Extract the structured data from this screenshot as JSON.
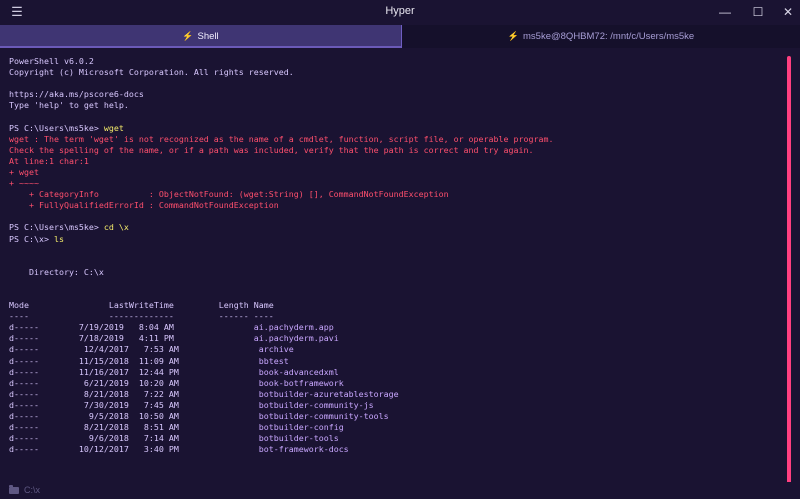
{
  "window": {
    "title": "Hyper",
    "menu_icon": "hamburger-icon",
    "minimize_icon": "minimize-icon",
    "maximize_icon": "maximize-icon",
    "close_icon": "close-icon"
  },
  "tabs": [
    {
      "label": "Shell",
      "icon": "bolt-icon",
      "active": true
    },
    {
      "label": "ms5ke@8QHBM72: /mnt/c/Users/ms5ke",
      "icon": "bolt-icon",
      "active": false
    }
  ],
  "terminal": {
    "lines": [
      {
        "segs": [
          {
            "t": "PowerShell v6.0.2",
            "c": "lav"
          }
        ]
      },
      {
        "segs": [
          {
            "t": "Copyright (c) Microsoft Corporation. All rights reserved.",
            "c": "lav"
          }
        ]
      },
      {
        "segs": [
          {
            "t": "",
            "c": "lav"
          }
        ]
      },
      {
        "segs": [
          {
            "t": "https://aka.ms/pscore6-docs",
            "c": "lav"
          }
        ]
      },
      {
        "segs": [
          {
            "t": "Type 'help' to get help.",
            "c": "lav"
          }
        ]
      },
      {
        "segs": [
          {
            "t": "",
            "c": "lav"
          }
        ]
      },
      {
        "segs": [
          {
            "t": "PS C:\\Users\\ms5ke> ",
            "c": "lav"
          },
          {
            "t": "wget",
            "c": "yellow"
          }
        ]
      },
      {
        "segs": [
          {
            "t": "wget : The term 'wget' is not recognized as the name of a cmdlet, function, script file, or operable program.",
            "c": "red"
          }
        ]
      },
      {
        "segs": [
          {
            "t": "Check the spelling of the name, or if a path was included, verify that the path is correct and try again.",
            "c": "red"
          }
        ]
      },
      {
        "segs": [
          {
            "t": "At line:1 char:1",
            "c": "red"
          }
        ]
      },
      {
        "segs": [
          {
            "t": "+ wget",
            "c": "red"
          }
        ]
      },
      {
        "segs": [
          {
            "t": "+ ~~~~",
            "c": "red"
          }
        ]
      },
      {
        "segs": [
          {
            "t": "    + CategoryInfo          : ObjectNotFound: (wget:String) [], CommandNotFoundException",
            "c": "red"
          }
        ]
      },
      {
        "segs": [
          {
            "t": "    + FullyQualifiedErrorId : CommandNotFoundException",
            "c": "red"
          }
        ]
      },
      {
        "segs": [
          {
            "t": "",
            "c": "lav"
          }
        ]
      },
      {
        "segs": [
          {
            "t": "PS C:\\Users\\ms5ke> ",
            "c": "lav"
          },
          {
            "t": "cd \\x",
            "c": "yellow"
          }
        ]
      },
      {
        "segs": [
          {
            "t": "PS C:\\x> ",
            "c": "lav"
          },
          {
            "t": "ls",
            "c": "yellow"
          }
        ]
      },
      {
        "segs": [
          {
            "t": "",
            "c": "lav"
          }
        ]
      },
      {
        "segs": [
          {
            "t": "",
            "c": "lav"
          }
        ]
      },
      {
        "segs": [
          {
            "t": "    Directory: C:\\x",
            "c": "lav"
          }
        ]
      },
      {
        "segs": [
          {
            "t": "",
            "c": "lav"
          }
        ]
      },
      {
        "segs": [
          {
            "t": "",
            "c": "lav"
          }
        ]
      },
      {
        "segs": [
          {
            "t": "Mode                LastWriteTime         Length Name",
            "c": "lav"
          }
        ]
      },
      {
        "segs": [
          {
            "t": "----                -------------         ------ ----",
            "c": "lav"
          }
        ]
      },
      {
        "segs": [
          {
            "t": "d-----        7/19/2019   8:04 AM                ",
            "c": "lav"
          },
          {
            "t": "ai.pachyderm.app",
            "c": "purple"
          }
        ]
      },
      {
        "segs": [
          {
            "t": "d-----        7/18/2019   4:11 PM                ",
            "c": "lav"
          },
          {
            "t": "ai.pachyderm.pavi",
            "c": "purple"
          }
        ]
      },
      {
        "segs": [
          {
            "t": "d-----         12/4/2017   7:53 AM                ",
            "c": "lav"
          },
          {
            "t": "archive",
            "c": "purple"
          }
        ]
      },
      {
        "segs": [
          {
            "t": "d-----        11/15/2018  11:09 AM                ",
            "c": "lav"
          },
          {
            "t": "bbtest",
            "c": "purple"
          }
        ]
      },
      {
        "segs": [
          {
            "t": "d-----        11/16/2017  12:44 PM                ",
            "c": "lav"
          },
          {
            "t": "book-advancedxml",
            "c": "purple"
          }
        ]
      },
      {
        "segs": [
          {
            "t": "d-----         6/21/2019  10:20 AM                ",
            "c": "lav"
          },
          {
            "t": "book-botframework",
            "c": "purple"
          }
        ]
      },
      {
        "segs": [
          {
            "t": "d-----         8/21/2018   7:22 AM                ",
            "c": "lav"
          },
          {
            "t": "botbuilder-azuretablestorage",
            "c": "purple"
          }
        ]
      },
      {
        "segs": [
          {
            "t": "d-----         7/30/2019   7:45 AM                ",
            "c": "lav"
          },
          {
            "t": "botbuilder-community-js",
            "c": "purple"
          }
        ]
      },
      {
        "segs": [
          {
            "t": "d-----          9/5/2018  10:50 AM                ",
            "c": "lav"
          },
          {
            "t": "botbuilder-community-tools",
            "c": "purple"
          }
        ]
      },
      {
        "segs": [
          {
            "t": "d-----         8/21/2018   8:51 AM                ",
            "c": "lav"
          },
          {
            "t": "botbuilder-config",
            "c": "purple"
          }
        ]
      },
      {
        "segs": [
          {
            "t": "d-----          9/6/2018   7:14 AM                ",
            "c": "lav"
          },
          {
            "t": "botbuilder-tools",
            "c": "purple"
          }
        ]
      },
      {
        "segs": [
          {
            "t": "d-----        10/12/2017   3:40 PM                ",
            "c": "lav"
          },
          {
            "t": "bot-framework-docs",
            "c": "purple"
          }
        ]
      }
    ]
  },
  "statusbar": {
    "cwd": "C:\\x",
    "folder_icon": "folder-icon"
  },
  "colors": {
    "background": "#1a1332",
    "active_tab": "#3f3573",
    "prompt_text": "#d9c8ff",
    "command_text": "#f5ec6b",
    "error_text": "#ff4f6d",
    "directory_text": "#c9a7ff",
    "scrollbar": "#ff3f80"
  }
}
